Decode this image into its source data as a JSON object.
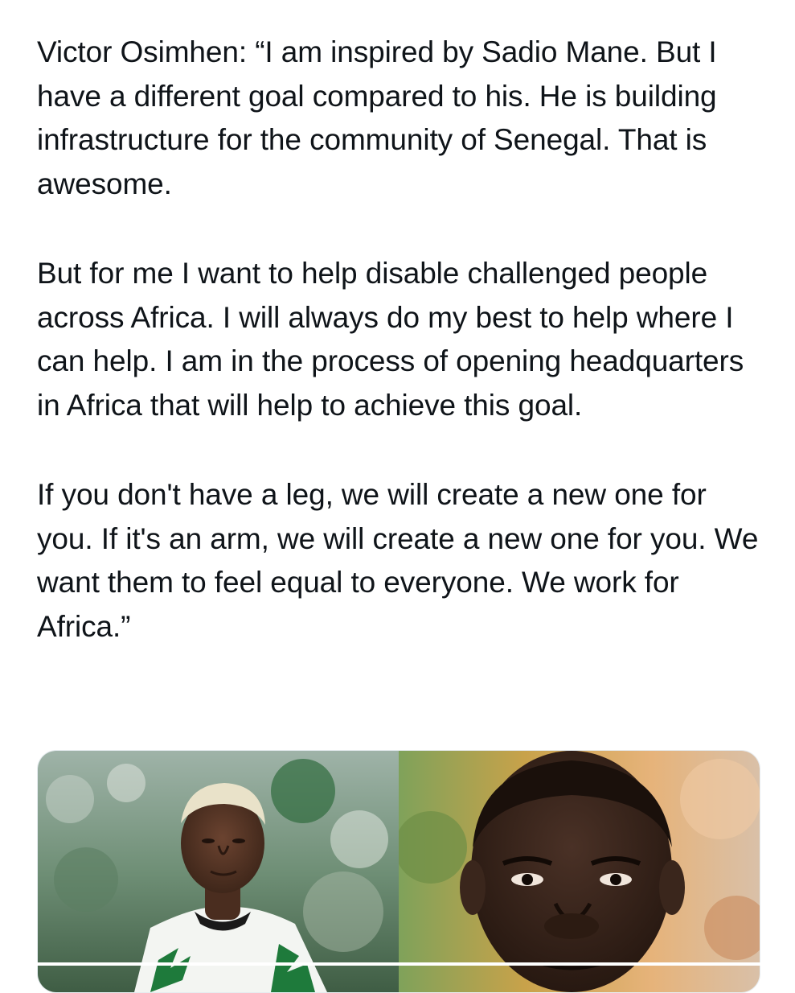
{
  "tweet": {
    "paragraphs": [
      "Victor Osimhen: “I am inspired by Sadio Mane. But I have a different goal compared to his. He is building infrastructure for the community of Senegal. That is awesome.",
      "But for me I want to help disable challenged people across Africa. I will always do my best to help where I can help. I am in the process of opening headquarters in Africa that will help to achieve this goal.",
      "If you don't have a leg, we will create a new one for you. If it's an arm, we will create a new one for you. We want them to feel equal to everyone. We work for Africa.”"
    ]
  },
  "media": {
    "photos": [
      {
        "subject": "Victor Osimhen",
        "icon": "player-photo"
      },
      {
        "subject": "Sadio Mane",
        "icon": "player-photo"
      }
    ]
  }
}
